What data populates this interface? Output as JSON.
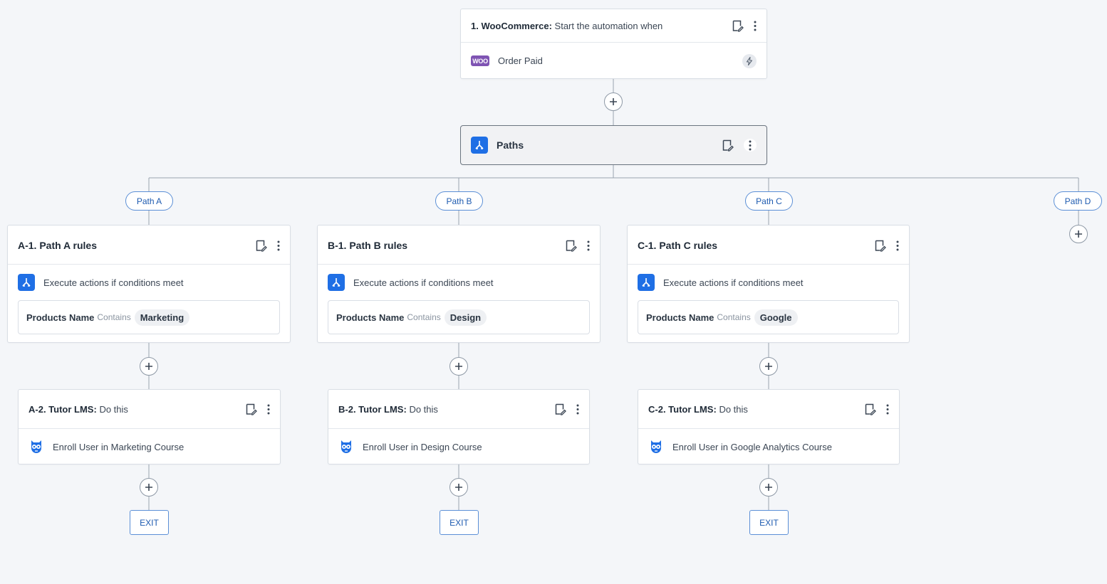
{
  "trigger": {
    "number_label": "1. WooCommerce:",
    "title_rest": "Start the automation when",
    "event": "Order Paid",
    "logo_text": "WOO"
  },
  "paths_node": {
    "label": "Paths"
  },
  "branches": [
    {
      "pill": "Path A",
      "rules_title": "A-1. Path A rules",
      "rules_desc": "Execute actions if conditions meet",
      "condition": {
        "field": "Products Name",
        "operator": "Contains",
        "value": "Marketing"
      },
      "action_label": "A-2. Tutor LMS:",
      "action_rest": "Do this",
      "action_desc": "Enroll User in Marketing Course",
      "exit": "EXIT"
    },
    {
      "pill": "Path B",
      "rules_title": "B-1. Path B rules",
      "rules_desc": "Execute actions if conditions meet",
      "condition": {
        "field": "Products Name",
        "operator": "Contains",
        "value": "Design"
      },
      "action_label": "B-2. Tutor LMS:",
      "action_rest": "Do this",
      "action_desc": "Enroll User in Design Course",
      "exit": "EXIT"
    },
    {
      "pill": "Path C",
      "rules_title": "C-1. Path C rules",
      "rules_desc": "Execute actions if conditions meet",
      "condition": {
        "field": "Products Name",
        "operator": "Contains",
        "value": "Google"
      },
      "action_label": "C-2. Tutor LMS:",
      "action_rest": "Do this",
      "action_desc": "Enroll User in Google Analytics Course",
      "exit": "EXIT"
    }
  ],
  "extra_path": {
    "pill": "Path D"
  },
  "colors": {
    "accent_blue": "#1f6fe5",
    "pill_border": "#5b8fd6",
    "woo_purple": "#7f54b3",
    "connector": "#9aa4af"
  }
}
